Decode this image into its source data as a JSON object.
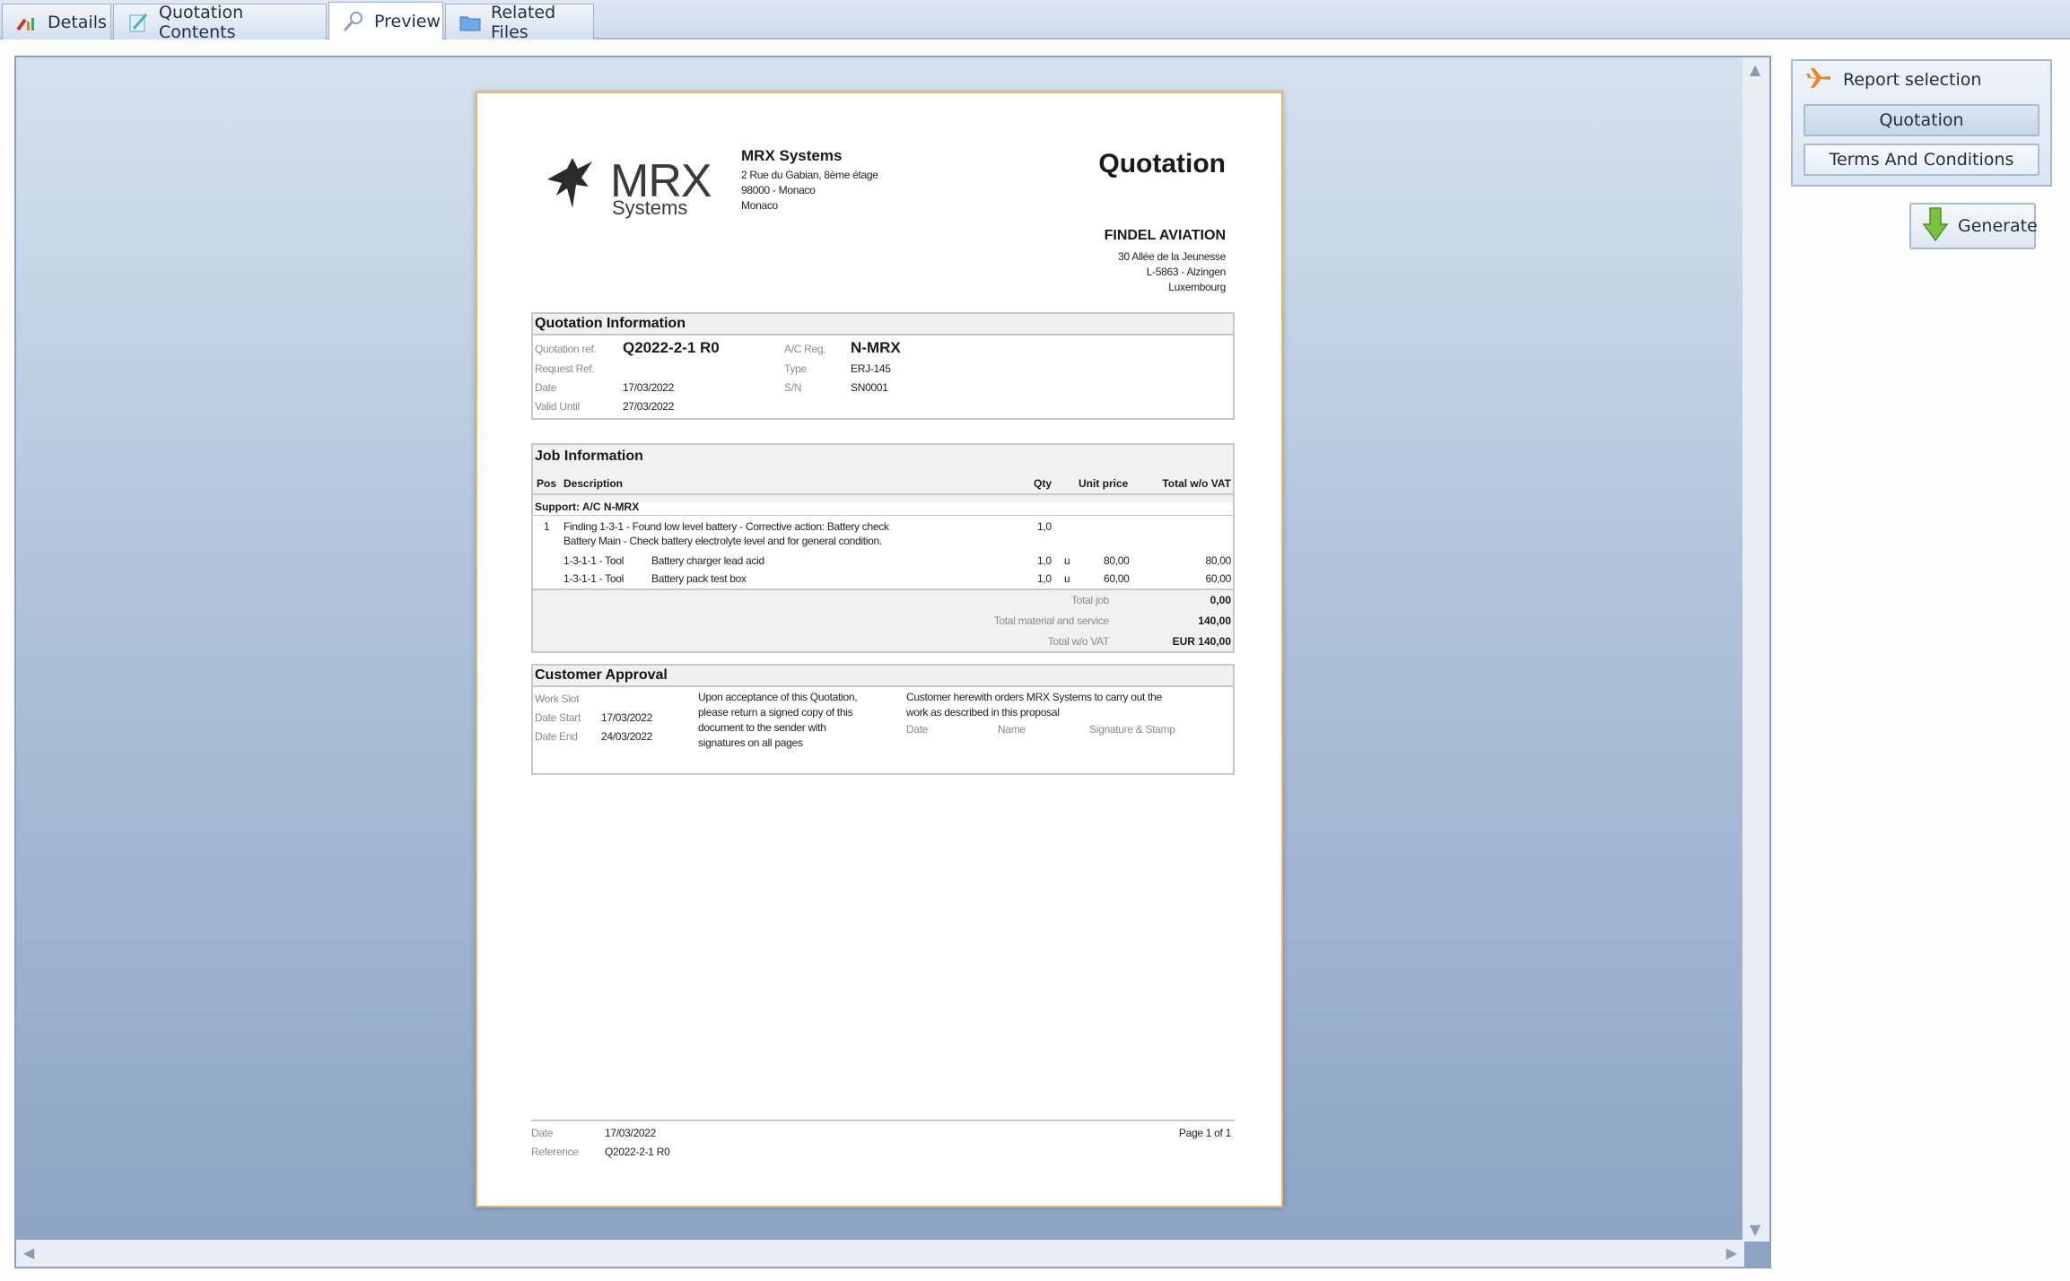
{
  "tabs": [
    {
      "label": "Details",
      "icon": "wrench-chart-icon"
    },
    {
      "label": "Quotation Contents",
      "icon": "pencil-icon"
    },
    {
      "label": "Preview",
      "icon": "magnifier-icon"
    },
    {
      "label": "Related Files",
      "icon": "folder-icon"
    }
  ],
  "active_tab": "Preview",
  "report": {
    "logo": {
      "word": "MRX",
      "sub": "Systems"
    },
    "company": {
      "name": "MRX Systems",
      "address1": "2 Rue du Gabian, 8ème étage",
      "address2": "98000 - Monaco",
      "address3": "Monaco"
    },
    "title": "Quotation",
    "customer": {
      "name": "FINDEL AVIATION",
      "address1": "30 Allée de la Jeunesse",
      "address2": "L-5863 - Alzingen",
      "address3": "Luxembourg"
    },
    "quotation_info": {
      "heading": "Quotation Information",
      "ref_label": "Quotation ref.",
      "ref": "Q2022-2-1 R0",
      "request_label": "Request Ref.",
      "date_label": "Date",
      "date": "17/03/2022",
      "valid_label": "Valid Until",
      "valid": "27/03/2022",
      "acreg_label": "A/C Reg.",
      "acreg": "N-MRX",
      "type_label": "Type",
      "type": "ERJ-145",
      "sn_label": "S/N",
      "sn": "SN0001"
    },
    "job_info": {
      "heading": "Job Information",
      "col_pos": "Pos",
      "col_desc": "Description",
      "col_qty": "Qty",
      "col_unit": "Unit price",
      "col_total": "Total w/o VAT",
      "support": "Support: A/C N-MRX",
      "finding_pos": "1",
      "finding_line1": "Finding 1-3-1 - Found low level battery - Corrective action: Battery check",
      "finding_line2": "Battery Main - Check battery electrolyte level and for general condition.",
      "finding_qty": "1,0",
      "items": [
        {
          "code": "1-3-1-1 - Tool",
          "desc": "Battery charger lead acid",
          "qty": "1,0",
          "unit": "u",
          "price": "80,00",
          "total": "80,00"
        },
        {
          "code": "1-3-1-1 - Tool",
          "desc": "Battery pack test box",
          "qty": "1,0",
          "unit": "u",
          "price": "60,00",
          "total": "60,00"
        }
      ],
      "total_job_label": "Total job",
      "total_job": "0,00",
      "total_mat_label": "Total material and service",
      "total_mat": "140,00",
      "total_vat_label": "Total w/o VAT",
      "total_vat": "EUR 140,00"
    },
    "approval": {
      "heading": "Customer Approval",
      "workslot_label": "Work Slot",
      "start_label": "Date Start",
      "start": "17/03/2022",
      "end_label": "Date End",
      "end": "24/03/2022",
      "note": [
        "Upon acceptance of this Quotation,",
        "please return a signed copy of this",
        "document to the sender with",
        "signatures on all pages"
      ],
      "order": [
        "Customer herewith orders MRX Systems to carry out the",
        "work as described in this proposal"
      ],
      "sig_date": "Date",
      "sig_name": "Name",
      "sig_stamp": "Signature & Stamp"
    },
    "footer": {
      "date_label": "Date",
      "date": "17/03/2022",
      "ref_label": "Reference",
      "ref": "Q2022-2-1 R0",
      "page": "Page 1 of 1"
    }
  },
  "report_selection": {
    "heading": "Report selection",
    "items": [
      "Quotation",
      "Terms And Conditions"
    ],
    "selected": "Quotation"
  },
  "generate_label": "Generate",
  "colors": {
    "accent_border": "#e7b56a",
    "panel": "#dbe5f2",
    "viewport_top": "#d6e1ee",
    "viewport_bottom": "#8ca4c2"
  }
}
